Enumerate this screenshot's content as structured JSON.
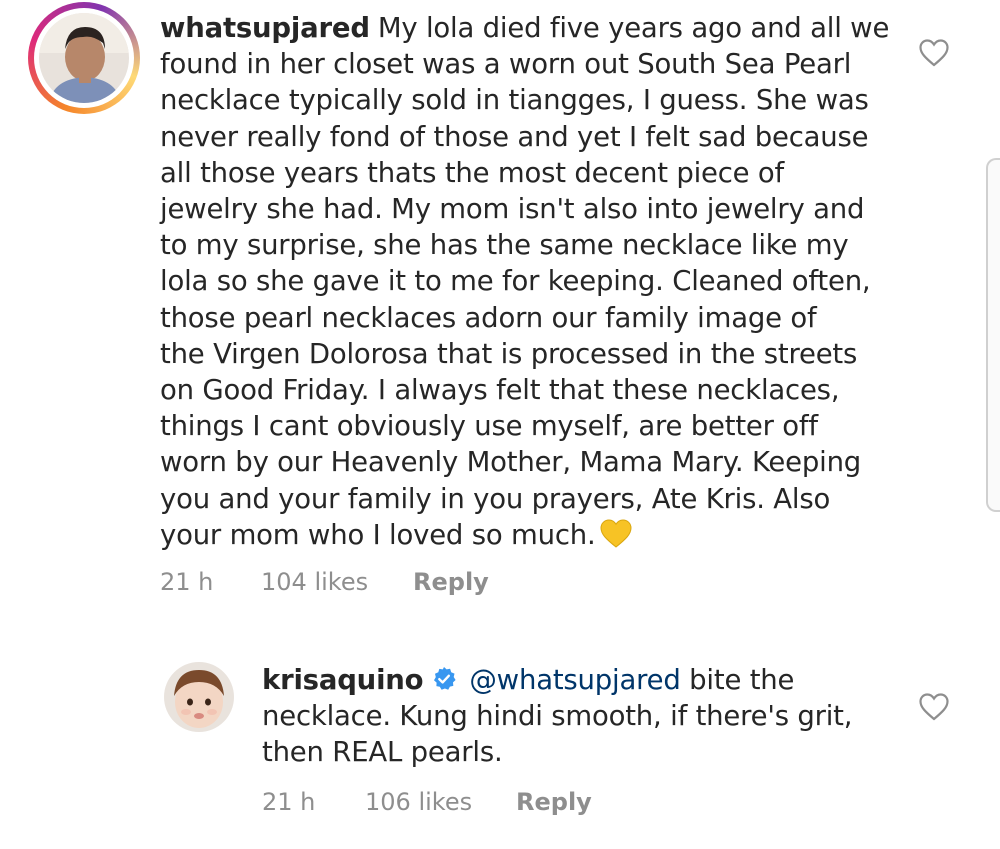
{
  "comments": [
    {
      "username": "whatsupjared",
      "verified": false,
      "avatar_icon": "user-photo-avatar",
      "lines": [
        "My lola died five years ago and all we",
        "found in her closet was a worn out South Sea Pearl",
        "necklace typically sold  in tiangges, I guess. She was",
        "never really fond of those and yet I felt sad because",
        "all those years thats the most decent piece of",
        "jewelry she had. My mom isn't also into jewelry and",
        "to my surprise, she has the same necklace like my",
        "lola so she gave it to me for keeping. Cleaned often,",
        "those pearl necklaces adorn our family image of",
        "the Virgen Dolorosa that is processed in the streets",
        "on Good Friday. I always felt that these necklaces,",
        "things I cant obviously use myself, are better off",
        "worn by our Heavenly Mother, Mama Mary. Keeping",
        "you and your family in you prayers, Ate Kris. Also",
        "your mom who I loved so much."
      ],
      "emoji": "yellow-heart-emoji",
      "time": "21 h",
      "likes": "104 likes",
      "reply": "Reply",
      "like_icon": "heart-outline-icon"
    },
    {
      "username": "krisaquino",
      "verified": true,
      "verified_icon": "verified-badge-icon",
      "avatar_icon": "baby-photo-avatar",
      "mention": "@whatsupjared",
      "lines": [
        " bite the",
        "necklace. Kung hindi smooth, if there's grit,",
        "then REAL pearls."
      ],
      "time": "21 h",
      "likes": "106 likes",
      "reply": "Reply",
      "like_icon": "heart-outline-icon"
    }
  ],
  "colors": {
    "text": "#262626",
    "meta": "#8e8e8e",
    "mention": "#003569",
    "verified": "#3897f0",
    "heart_emoji": "#f7c325"
  }
}
